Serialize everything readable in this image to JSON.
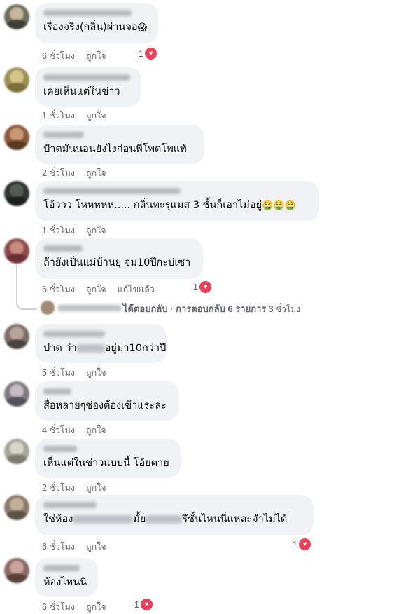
{
  "comments": [
    {
      "text": "เรื่องจริง(กลิ่น)ผ่านจอ",
      "emoji": "😱",
      "time": "6 ชั่วโมง",
      "like": "ถูกใจ",
      "reactions": "1"
    },
    {
      "text": "เคยเห็นแต่ในข่าว",
      "time": "1 ชั่วโมง",
      "like": "ถูกใจ"
    },
    {
      "text": "ป้าดมันนอนยังไงก่อนพี่โพดโพแท้",
      "time": "2 ชั่วโมง",
      "like": "ถูกใจ"
    },
    {
      "text": "โอ้ววว โหหหหห..... กลิ่นทะรุแมส 3 ชั้นก็เอาไม่อยู่",
      "emoji": "🤮🤮🤮",
      "time": "1 ชั่วโมง",
      "like": "ถูกใจ"
    },
    {
      "text": "ถ้ายังเป็นแม่บ้านยุ จ่ม10ปีกะบ่เซา",
      "time": "6 ชั่วโมง",
      "like": "ถูกใจ",
      "edited": "แก้ไขแล้ว",
      "reactions": "1"
    },
    {
      "text_before": "ปาด ว่า",
      "text_after": "อยู่มา10กว่าปี",
      "time": "5 ชั่วโมง",
      "like": "ถูกใจ"
    },
    {
      "text": "สื่อหลายๆช่องต้องเข้าแระล่ะ",
      "time": "4 ชั่วโมง",
      "like": "ถูกใจ"
    },
    {
      "text": "เห็นแต่ในข่าวแบบนี้ โอ้ยตาย",
      "time": "2 ชั่วโมง",
      "like": "ถูกใจ"
    },
    {
      "text_before": "ใช่ห้อง",
      "text_middle": "มั้ย",
      "text_after": "รึชั้นไหนนี่แหละจำไม่ได้",
      "time": "6 ชั่วโมง",
      "like": "ถูกใจ",
      "reactions": "1"
    },
    {
      "text": "ห้องไหนนิ",
      "time": "6 ชั่วโมง",
      "like": "ถูกใจ",
      "reactions": "1"
    }
  ],
  "replies": {
    "text": "ได้ตอบกลับ · การตอบกลับ 6 รายการ",
    "time": "3 ชั่วโมง"
  },
  "icons": {
    "heart": "heart-reaction-icon"
  },
  "colors": {
    "bubble": "#f0f2f5",
    "meta": "#65676b",
    "heart": "#f33e58"
  }
}
